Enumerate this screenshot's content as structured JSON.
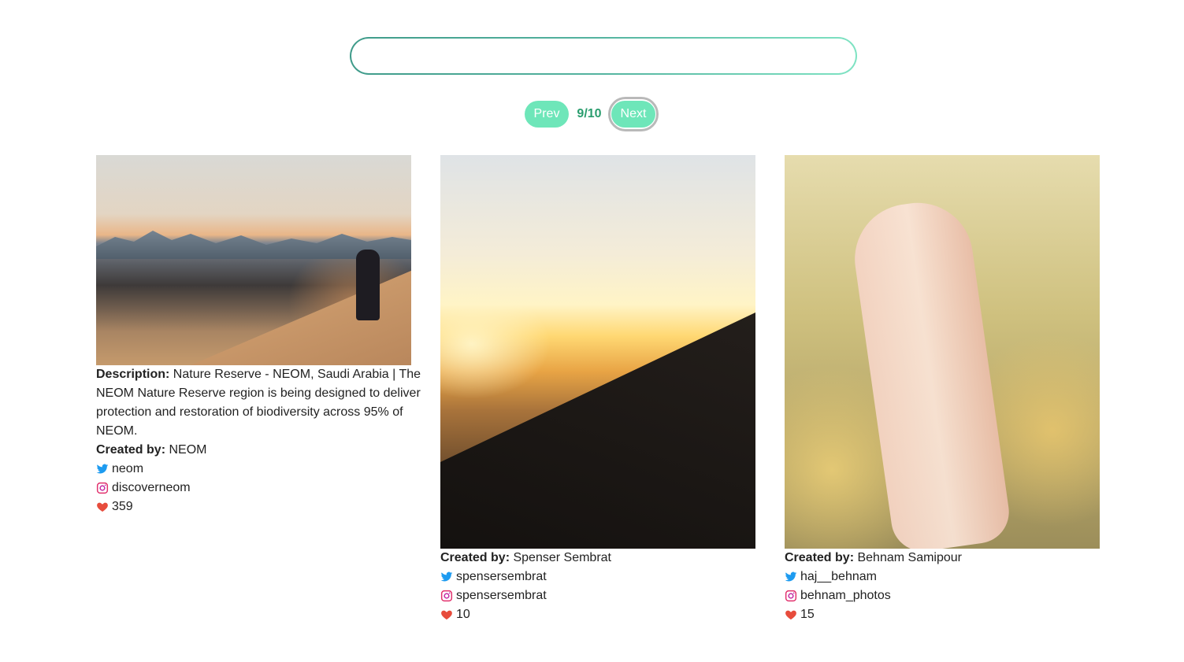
{
  "search": {
    "value": "",
    "placeholder": ""
  },
  "pagination": {
    "prev_label": "Prev",
    "page_indicator": "9/10",
    "next_label": "Next"
  },
  "labels": {
    "description": "Description:",
    "created_by": "Created by:"
  },
  "icons": {
    "twitter": "twitter-icon",
    "instagram": "instagram-icon",
    "likes": "heart-icon"
  },
  "colors": {
    "button": "#6ee6b9",
    "page_indicator": "#2a9d6e",
    "twitter": "#1d9bf0",
    "instagram": "#e1306c",
    "heart": "#e74c3c"
  },
  "cards": [
    {
      "description": "Nature Reserve - NEOM, Saudi Arabia | The NEOM Nature Reserve region is being designed to deliver protection and restoration of biodiversity across 95% of NEOM.",
      "creator": "NEOM",
      "twitter": "neom",
      "instagram": "discoverneom",
      "likes": "359"
    },
    {
      "creator": "Spenser Sembrat",
      "twitter": "spensersembrat",
      "instagram": "spensersembrat",
      "likes": "10"
    },
    {
      "creator": "Behnam Samipour",
      "twitter": "haj__behnam",
      "instagram": "behnam_photos",
      "likes": "15"
    }
  ]
}
